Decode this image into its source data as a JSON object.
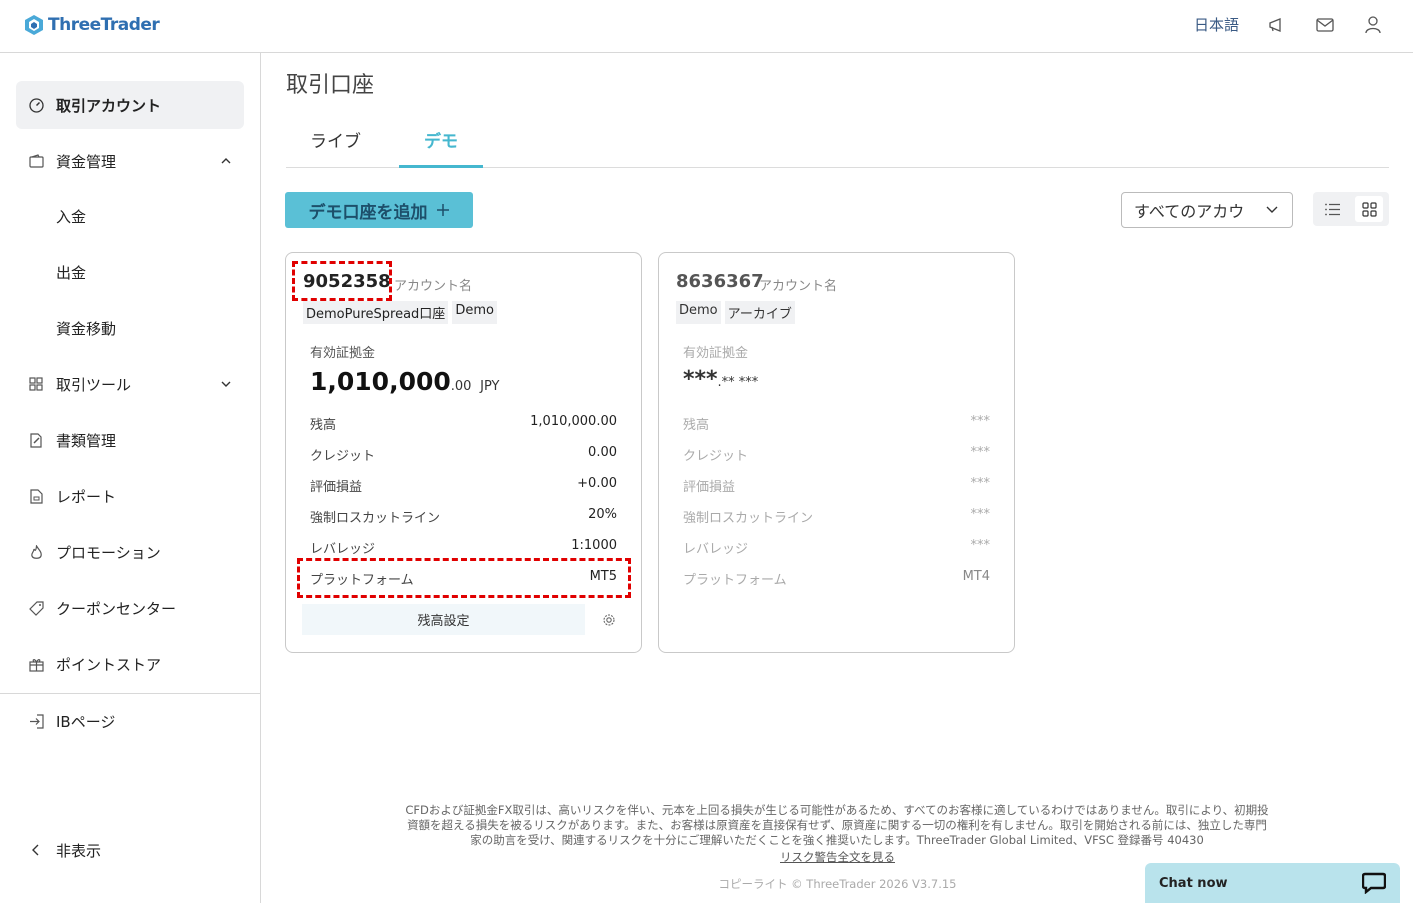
{
  "header": {
    "brand": "ThreeTrader",
    "language": "日本語"
  },
  "sidebar": {
    "items": [
      {
        "label": "取引アカウント",
        "icon": "dashboard-gauge-icon",
        "active": true
      },
      {
        "label": "資金管理",
        "icon": "wallet-icon",
        "expanded": true
      },
      {
        "label": "取引ツール",
        "icon": "grid-tools-icon",
        "expanded": false
      },
      {
        "label": "書類管理",
        "icon": "document-edit-icon"
      },
      {
        "label": "レポート",
        "icon": "report-file-icon"
      },
      {
        "label": "プロモーション",
        "icon": "flame-icon"
      },
      {
        "label": "クーポンセンター",
        "icon": "tag-icon"
      },
      {
        "label": "ポイントストア",
        "icon": "gift-icon"
      }
    ],
    "sub_items": [
      "入金",
      "出金",
      "資金移動"
    ],
    "ib_page": "IBページ",
    "hide": "非表示"
  },
  "main": {
    "title": "取引口座",
    "tabs": [
      "ライブ",
      "デモ"
    ],
    "active_tab": "デモ",
    "add_button": "デモ口座を追加",
    "filter_value": "すべてのアカウ"
  },
  "cards": [
    {
      "account_no": "9052358",
      "account_name": "アカウント名",
      "tags": [
        "DemoPureSpread口座",
        "Demo"
      ],
      "equity_label": "有効証拠金",
      "equity_main": "1,010,000",
      "equity_decimal": ".00",
      "equity_currency": "JPY",
      "rows": [
        {
          "label": "残高",
          "value": "1,010,000.00"
        },
        {
          "label": "クレジット",
          "value": "0.00"
        },
        {
          "label": "評価損益",
          "value": "+0.00"
        },
        {
          "label": "強制ロスカットライン",
          "value": "20%"
        },
        {
          "label": "レバレッジ",
          "value": "1:1000"
        },
        {
          "label": "プラットフォーム",
          "value": "MT5"
        }
      ],
      "balance_button": "残高設定"
    },
    {
      "account_no": "8636367",
      "account_name": "アカウント名",
      "tags": [
        "Demo",
        "アーカイブ"
      ],
      "equity_label": "有効証拠金",
      "equity_main": "***",
      "equity_decimal": ".** ***",
      "rows": [
        {
          "label": "残高",
          "value": "***"
        },
        {
          "label": "クレジット",
          "value": "***"
        },
        {
          "label": "評価損益",
          "value": "***"
        },
        {
          "label": "強制ロスカットライン",
          "value": "***"
        },
        {
          "label": "レバレッジ",
          "value": "***"
        },
        {
          "label": "プラットフォーム",
          "value": "MT4"
        }
      ]
    }
  ],
  "footer": {
    "disclaimer": "CFDおよび証拠金FX取引は、高いリスクを伴い、元本を上回る損失が生じる可能性があるため、すべてのお客様に適しているわけではありません。取引により、初期投資額を超える損失を被るリスクがあります。また、お客様は原資産を直接保有せず、原資産に関する一切の権利を有しません。取引を開始される前には、独立した専門家の助言を受け、関連するリスクを十分にご理解いただくことを強く推奨いたします。ThreeTrader Global Limited、VFSC 登録番号 40430",
    "risk_link": "リスク警告全文を見る",
    "copyright": "コピーライト © ThreeTrader 2026 V3.7.15"
  },
  "chat": {
    "label": "Chat now"
  },
  "colors": {
    "accent": "#45b7cf",
    "button": "#5ac0d6",
    "brand": "#2f6fb1",
    "highlight": "#e00000"
  }
}
